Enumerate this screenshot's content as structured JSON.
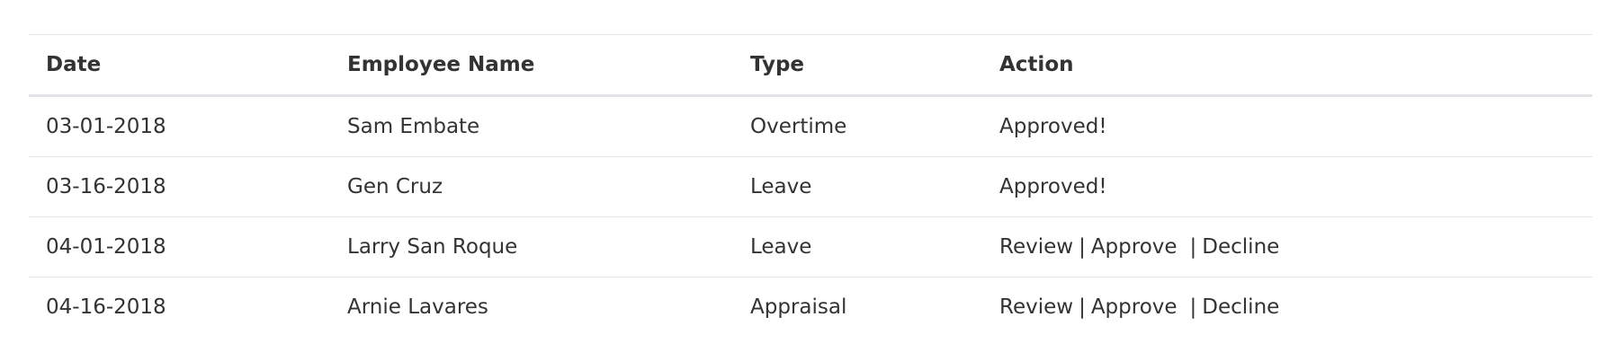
{
  "table": {
    "headers": {
      "date": "Date",
      "employee_name": "Employee Name",
      "type": "Type",
      "action": "Action"
    },
    "separator": "|",
    "rows": [
      {
        "date": "03-01-2018",
        "employee_name": "Sam Embate",
        "type": "Overtime",
        "action_status": "Approved!"
      },
      {
        "date": "03-16-2018",
        "employee_name": "Gen Cruz",
        "type": "Leave",
        "action_status": "Approved!"
      },
      {
        "date": "04-01-2018",
        "employee_name": "Larry San Roque",
        "type": "Leave",
        "actions": {
          "review": "Review",
          "approve": "Approve",
          "decline": "Decline"
        }
      },
      {
        "date": "04-16-2018",
        "employee_name": "Arnie Lavares",
        "type": "Appraisal",
        "actions": {
          "review": "Review",
          "approve": "Approve",
          "decline": "Decline"
        }
      }
    ]
  }
}
